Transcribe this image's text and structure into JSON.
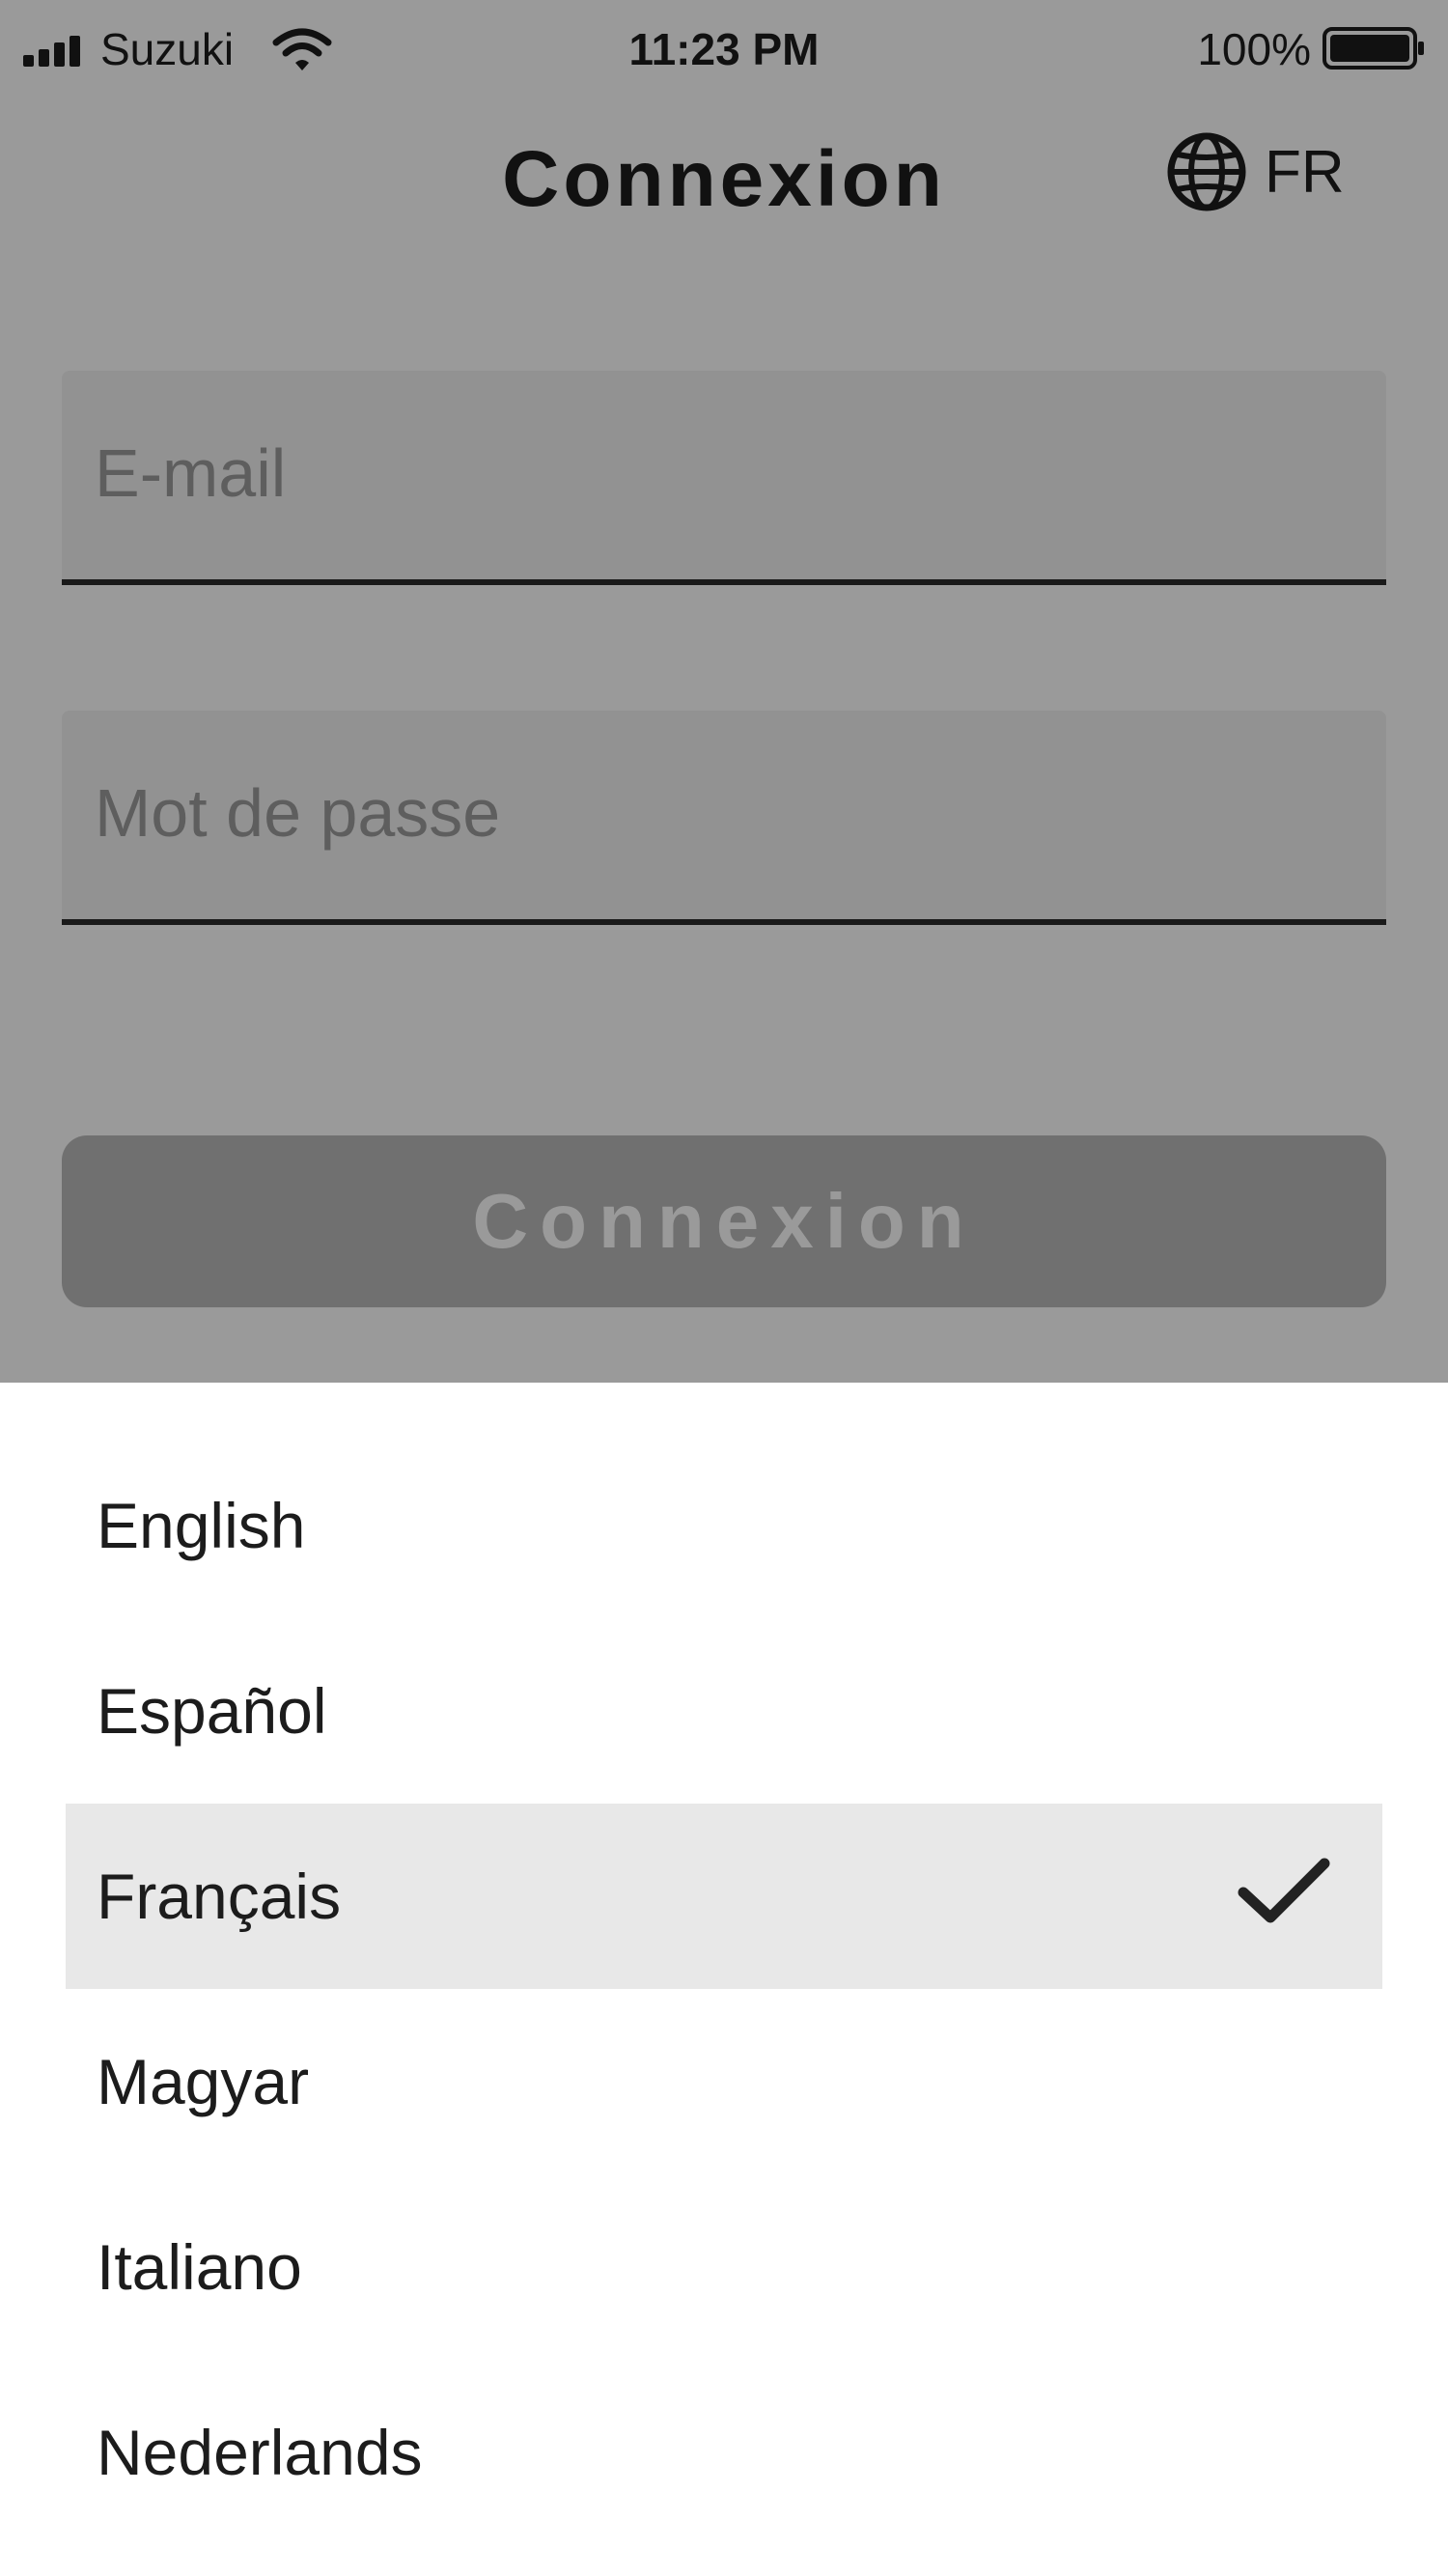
{
  "status_bar": {
    "carrier": "Suzuki",
    "time": "11:23 PM",
    "battery": "100%",
    "signal_icon": "signal-bars-icon",
    "wifi_icon": "wifi-icon",
    "battery_icon": "battery-full-icon"
  },
  "header": {
    "title": "Connexion",
    "language_code": "FR",
    "language_icon": "globe-icon"
  },
  "form": {
    "email_placeholder": "E-mail",
    "email_value": "",
    "password_placeholder": "Mot de passe",
    "password_value": "",
    "submit_label": "Connexion",
    "submit_enabled": false
  },
  "language_sheet": {
    "items": [
      {
        "label": "English",
        "selected": false
      },
      {
        "label": "Español",
        "selected": false
      },
      {
        "label": "Français",
        "selected": true
      },
      {
        "label": "Magyar",
        "selected": false
      },
      {
        "label": "Italiano",
        "selected": false
      },
      {
        "label": "Nederlands",
        "selected": false
      }
    ],
    "check_icon": "checkmark-icon"
  },
  "colors": {
    "dim_overlay": "#9a9a9a",
    "field_background": "#929292",
    "button_disabled": "#707070",
    "selected_row": "#e8e8e8",
    "text": "#1c1c1c"
  }
}
